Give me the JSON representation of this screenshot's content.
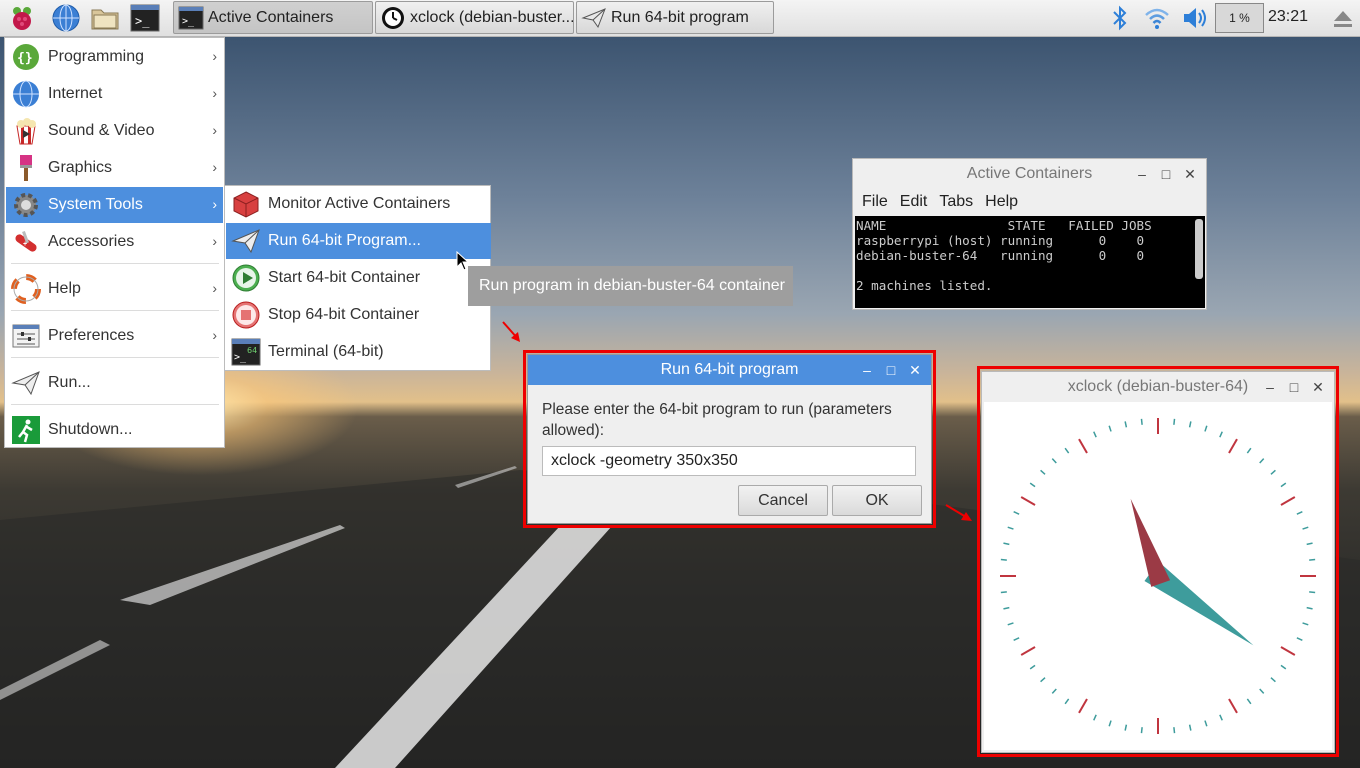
{
  "taskbar": {
    "tasks": [
      {
        "label": "Active Containers"
      },
      {
        "label": "xclock (debian-buster..."
      },
      {
        "label": "Run 64-bit program"
      }
    ],
    "cpu": "1 %",
    "time": "23:21"
  },
  "main_menu": {
    "items": [
      {
        "label": "Programming"
      },
      {
        "label": "Internet"
      },
      {
        "label": "Sound & Video"
      },
      {
        "label": "Graphics"
      },
      {
        "label": "System Tools"
      },
      {
        "label": "Accessories"
      },
      {
        "label": "Help"
      },
      {
        "label": "Preferences"
      },
      {
        "label": "Run..."
      },
      {
        "label": "Shutdown..."
      }
    ]
  },
  "sub_menu": {
    "items": [
      {
        "label": "Monitor Active Containers"
      },
      {
        "label": "Run 64-bit Program..."
      },
      {
        "label": "Start 64-bit Container"
      },
      {
        "label": "Stop 64-bit Container"
      },
      {
        "label": "Terminal (64-bit)"
      }
    ]
  },
  "tooltip": "Run program in debian-buster-64 container",
  "containers_window": {
    "title": "Active Containers",
    "menu": [
      "File",
      "Edit",
      "Tabs",
      "Help"
    ],
    "terminal": "NAME                STATE   FAILED JOBS\nraspberrypi (host) running      0    0\ndebian-buster-64   running      0    0\n\n2 machines listed."
  },
  "run_dialog": {
    "title": "Run 64-bit program",
    "prompt": "Please enter the 64-bit program to run (parameters allowed):",
    "value": "xclock -geometry 350x350",
    "cancel_label": "Cancel",
    "ok_label": "OK"
  },
  "xclock_window": {
    "title": "xclock (debian-buster-64)"
  },
  "colors": {
    "accent": "#4d8fde",
    "highlight_outline": "#ee0000",
    "clock_hour_hand": "#9b3a45",
    "clock_minute_hand": "#3e9c9c",
    "clock_ticks_major": "#c0353f",
    "clock_ticks_minor": "#3e9c9c"
  },
  "clock_time": {
    "hour": 23,
    "minute": 21
  }
}
